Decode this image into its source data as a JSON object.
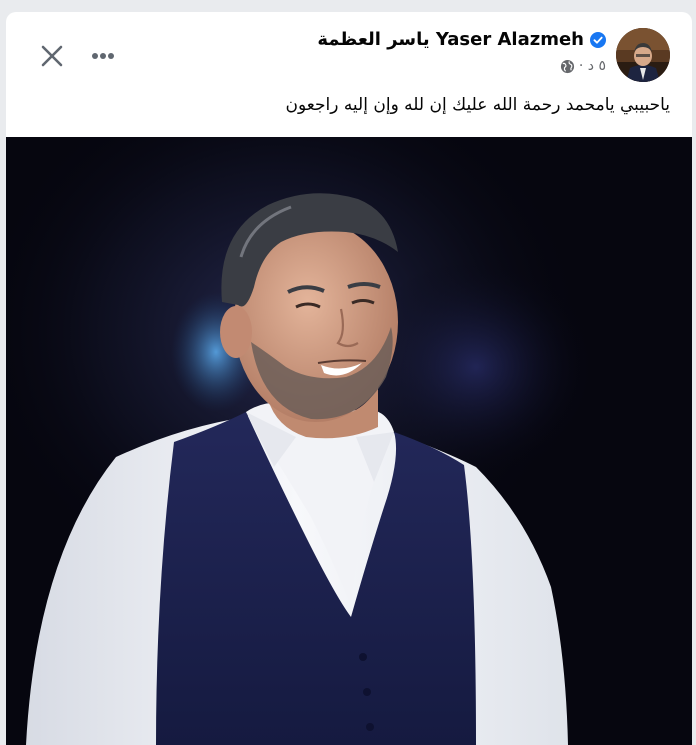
{
  "post": {
    "author_name": "Yaser Alazmeh ياسر العظمة",
    "verified": true,
    "time": "٥ د ·",
    "privacy": "globe-icon",
    "caption": "ياحبيبي يامحمد  رحمة الله عليك إن لله وإن إليه راجعون"
  },
  "actions": {
    "close": "close-icon",
    "more": "more-options-icon"
  },
  "colors": {
    "verified_blue": "#1877f2",
    "text_primary": "#050505",
    "text_secondary": "#65676b",
    "photo_background": "#06060f",
    "vest": "#1b1f45",
    "shirt": "#f3f4f6"
  }
}
